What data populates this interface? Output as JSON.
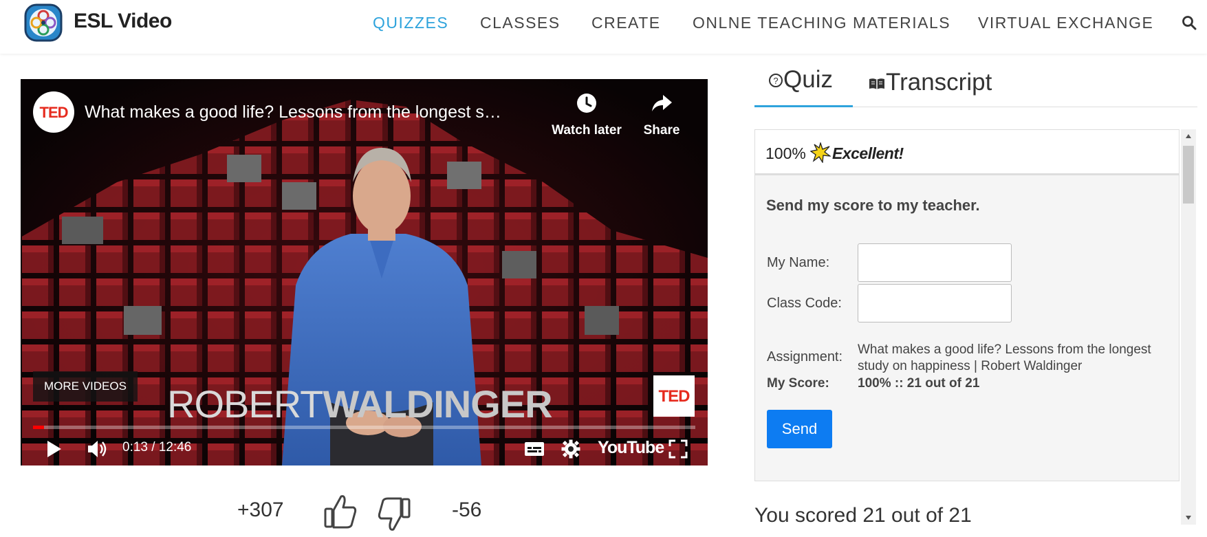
{
  "header": {
    "brand": "ESL Video",
    "nav": [
      "QUIZZES",
      "CLASSES",
      "CREATE",
      "ONLNE TEACHING MATERIALS",
      "VIRTUAL EXCHANGE"
    ],
    "active_nav": "QUIZZES",
    "accent_color": "#2ea3dc"
  },
  "video": {
    "channel_logo": "TED",
    "title": "What makes a good life? Lessons from the longest s…",
    "watch_later_label": "Watch later",
    "share_label": "Share",
    "more_videos_label": "MORE VIDEOS",
    "overlay_first": "ROBERT",
    "overlay_last": "WALDINGER",
    "corner_logo": "TED",
    "time": "0:13 / 12:46",
    "progress_fraction": 0.017,
    "youtube_label": "YouTube"
  },
  "votes": {
    "up": "+307",
    "down": "-56"
  },
  "tabs": {
    "quiz": "Quiz",
    "transcript": "Transcript",
    "active": "Quiz"
  },
  "result": {
    "percent": "100%",
    "word": "Excellent!"
  },
  "send_form": {
    "heading": "Send my score to my teacher.",
    "name_label": "My Name:",
    "name_value": "",
    "class_code_label": "Class Code:",
    "class_code_value": "",
    "assignment_label": "Assignment:",
    "assignment_value": "What makes a good life? Lessons from the longest study on happiness | Robert Waldinger",
    "score_label": "My Score:",
    "score_value": "100% :: 21 out of 21",
    "send_label": "Send",
    "button_color": "#0d7cf2"
  },
  "summary": "You scored 21 out of 21"
}
